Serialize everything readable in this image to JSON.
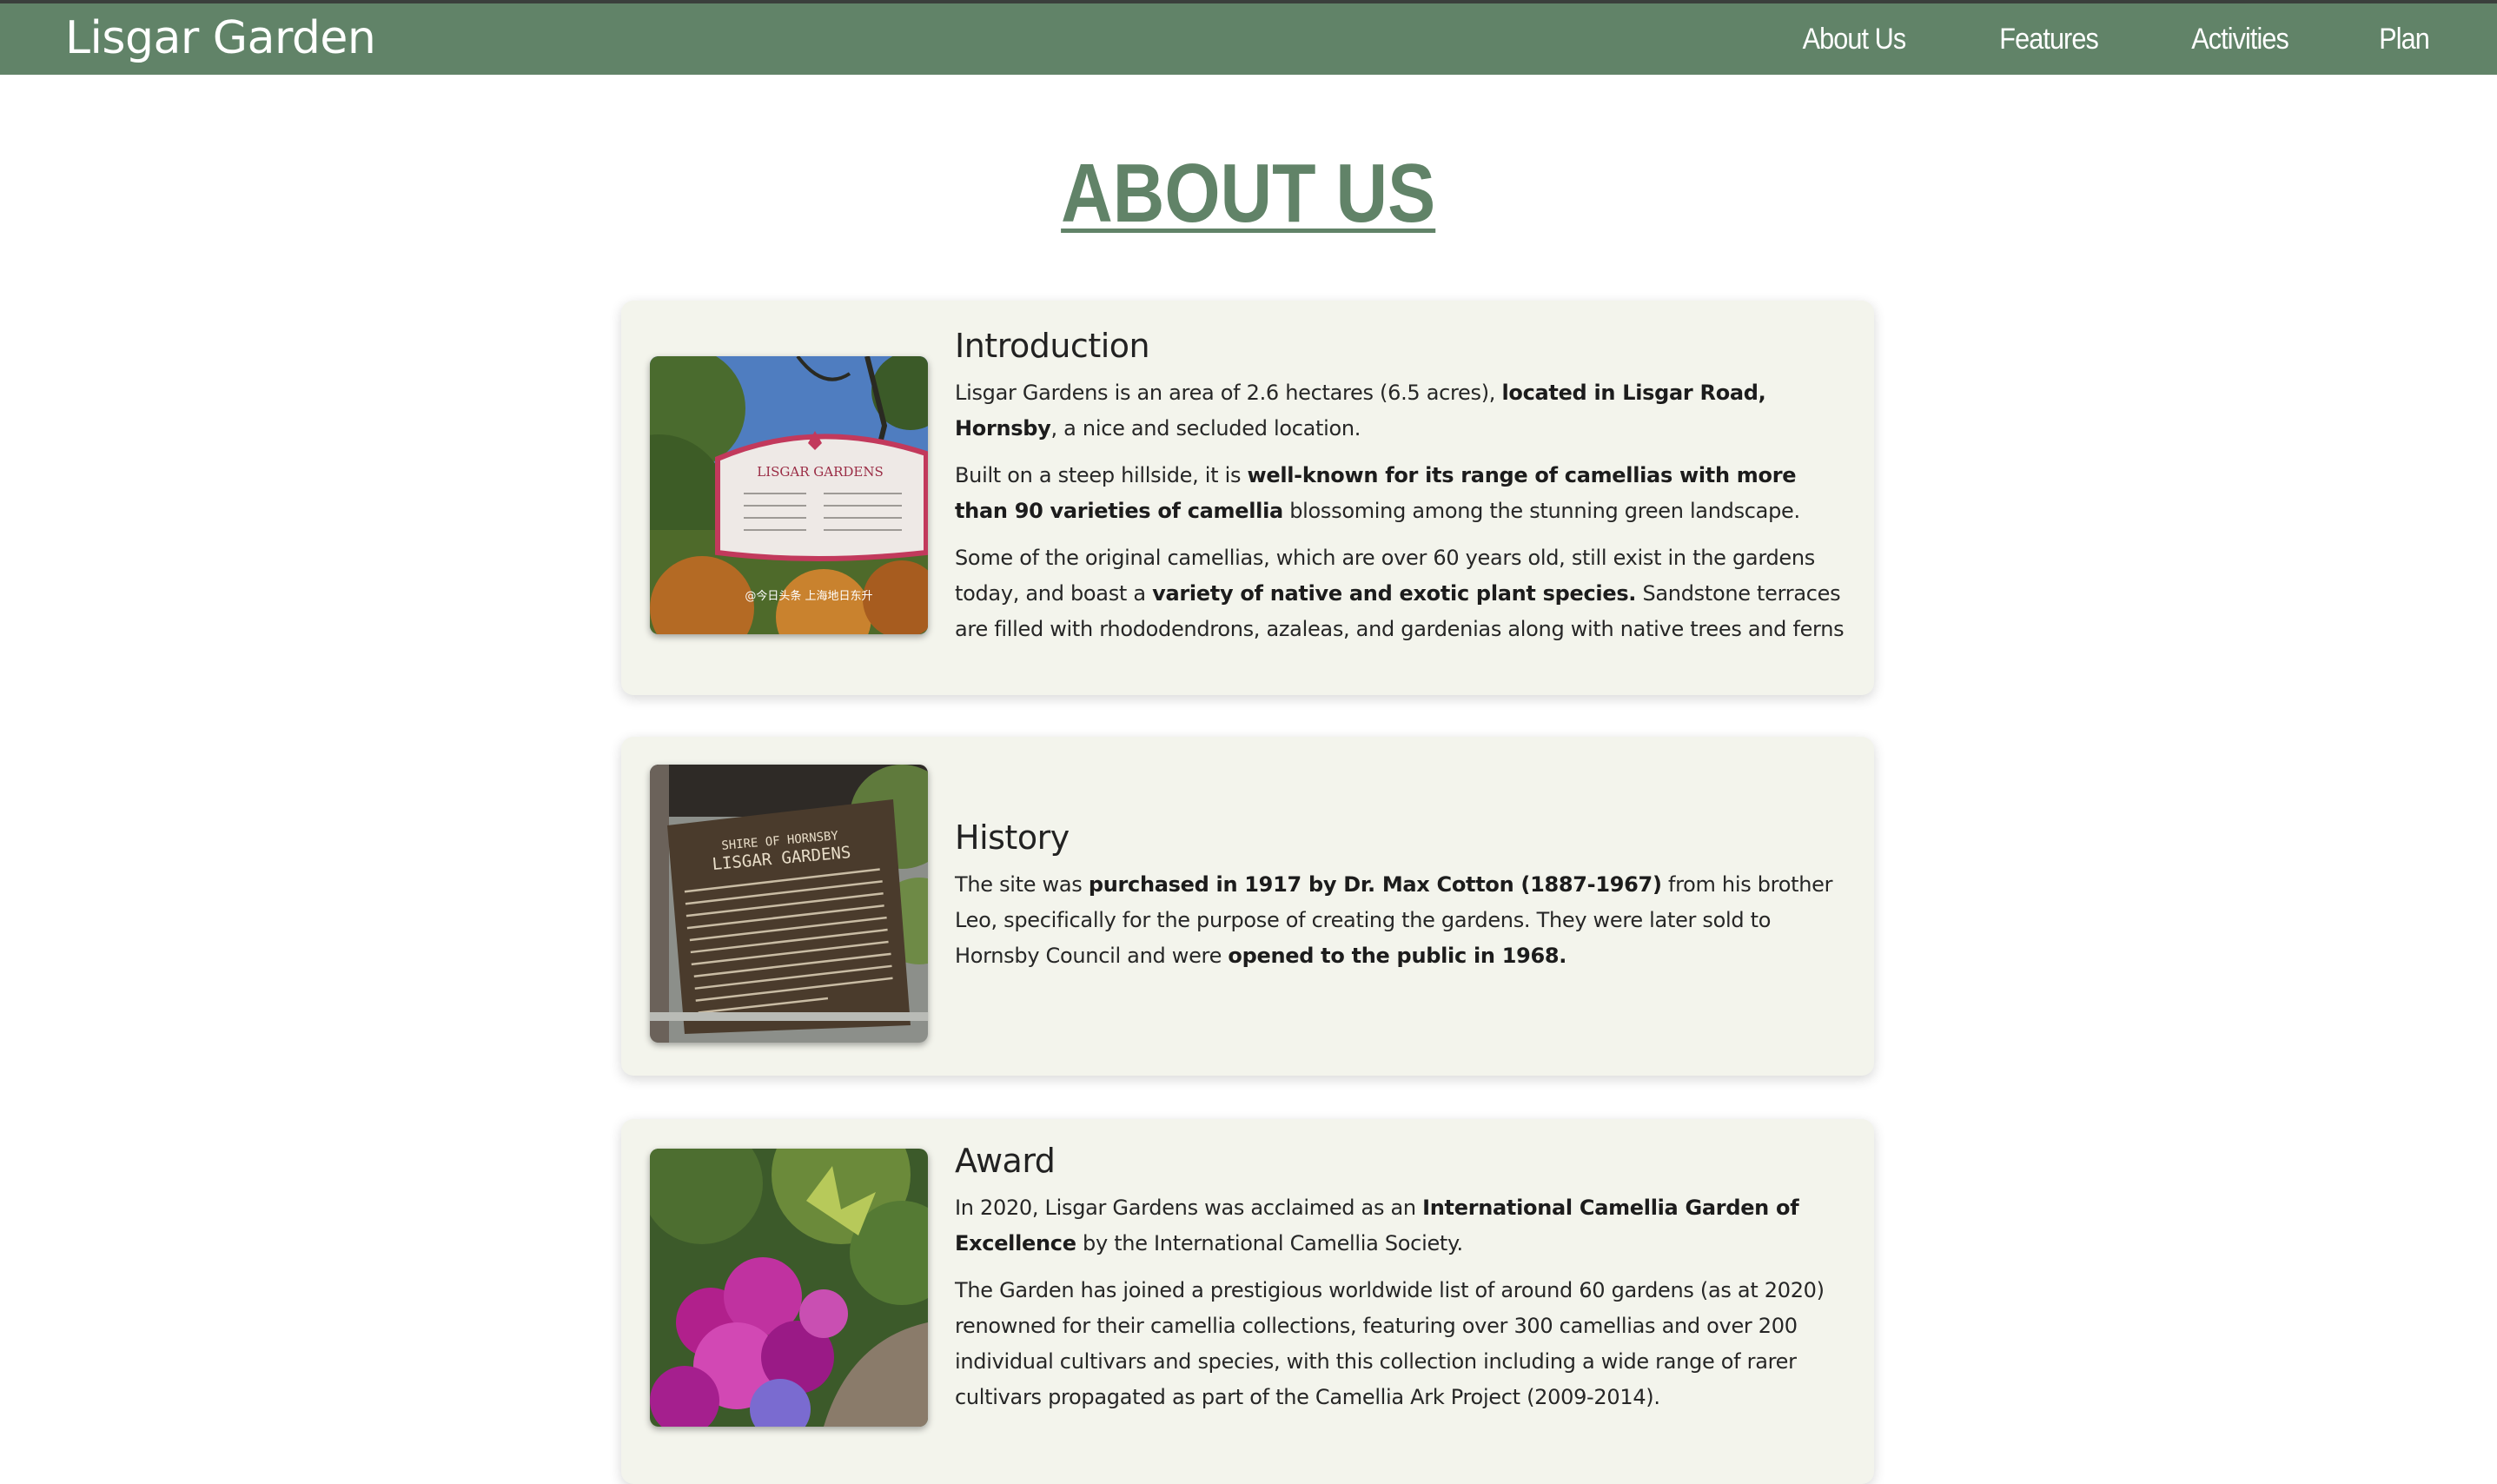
{
  "header": {
    "brand": "Lisgar Garden",
    "nav": [
      "About Us",
      "Features",
      "Activities",
      "Plan"
    ]
  },
  "page": {
    "title": "ABOUT US"
  },
  "colors": {
    "accent": "#618368",
    "card_bg": "#f3f4ec"
  },
  "sections": [
    {
      "heading": "Introduction",
      "image_icon": "garden-sign-photo",
      "image_sign_text": "LISGAR GARDENS",
      "image_watermark": "@今日头条 上海地日东升",
      "paragraphs": [
        [
          {
            "t": "Lisgar Gardens is an area of 2.6 hectares (6.5 acres), "
          },
          {
            "t": "located in Lisgar Road, Hornsby",
            "b": true
          },
          {
            "t": ", a nice and secluded location."
          }
        ],
        [
          {
            "t": "Built on a steep hillside, it is "
          },
          {
            "t": "well-known for its range of camellias with more than 90 varieties of camellia",
            "b": true
          },
          {
            "t": " blossoming among the stunning green landscape."
          }
        ],
        [
          {
            "t": "Some of the original camellias, which are over 60 years old, still exist in the gardens today, and boast a "
          },
          {
            "t": "variety of native and exotic plant species.",
            "b": true
          },
          {
            "t": " Sandstone terraces are filled with rhododendrons, azaleas, and gardenias along with native trees and ferns"
          }
        ]
      ]
    },
    {
      "heading": "History",
      "image_icon": "history-plaque-photo",
      "image_sign_text": [
        "SHIRE OF HORNSBY",
        "LISGAR GARDENS"
      ],
      "paragraphs": [
        [
          {
            "t": "The site was "
          },
          {
            "t": "purchased in 1917 by Dr. Max Cotton (1887-1967)",
            "b": true
          },
          {
            "t": " from his brother Leo, specifically for the purpose of creating the gardens. They were later sold to Hornsby Council and were "
          },
          {
            "t": "opened to the public in 1968.",
            "b": true
          }
        ]
      ]
    },
    {
      "heading": "Award",
      "image_icon": "flowers-photo",
      "paragraphs": [
        [
          {
            "t": "In 2020, Lisgar Gardens was acclaimed as an "
          },
          {
            "t": "International Camellia Garden of Excellence",
            "b": true
          },
          {
            "t": " by the International Camellia Society."
          }
        ],
        [
          {
            "t": "The Garden has joined a prestigious worldwide list of around 60 gardens (as at 2020) renowned for their camellia collections, featuring over 300 camellias and over 200 individual cultivars and species, with this collection including a wide range of rarer cultivars propagated as part of the Camellia Ark Project (2009-2014)."
          }
        ]
      ]
    }
  ]
}
